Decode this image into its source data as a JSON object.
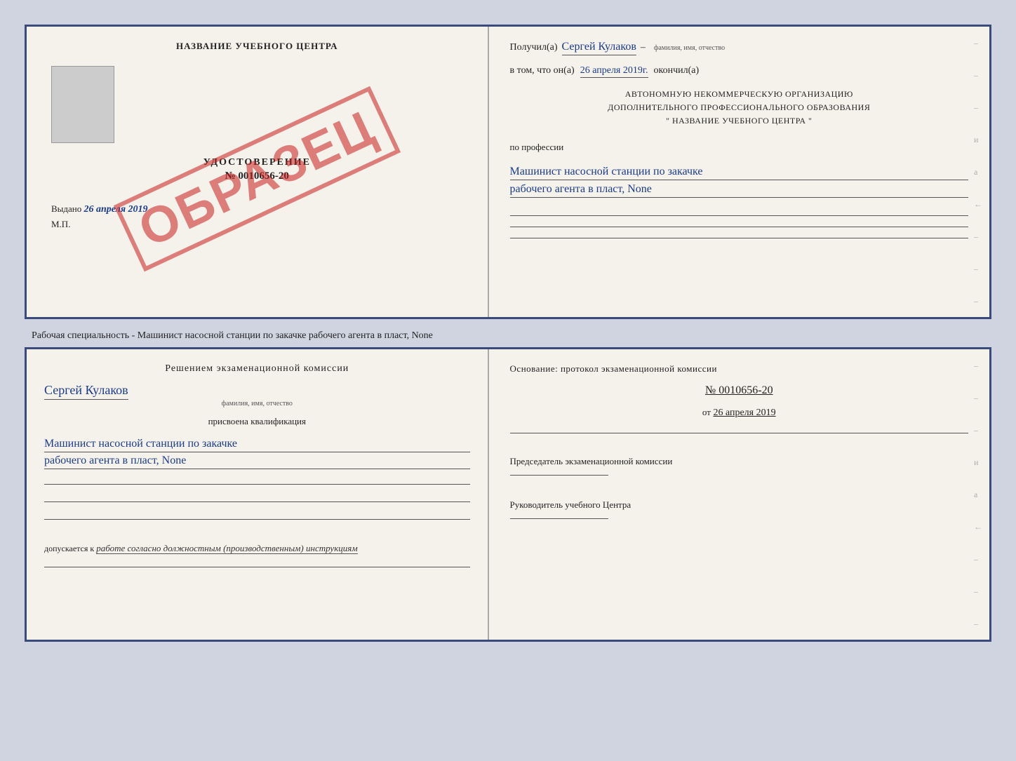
{
  "document": {
    "top_left": {
      "title": "НАЗВАНИЕ УЧЕБНОГО ЦЕНТРА",
      "photo_label": "photo",
      "udost_title": "УДОСТОВЕРЕНИЕ",
      "udost_number": "№ 0010656-20",
      "vydano_label": "Выдано",
      "vydano_date": "26 апреля 2019",
      "mp_label": "М.П.",
      "stamp": "ОБРАЗЕЦ"
    },
    "top_right": {
      "poluchil_label": "Получил(a)",
      "poluchil_name": "Сергей Кулаков",
      "familiya_hint": "фамилия, имя, отчество",
      "vtom_label": "в том, что он(а)",
      "vtom_date": "26 апреля 2019г.",
      "okonchil_label": "окончил(а)",
      "org_line1": "АВТОНОМНУЮ НЕКОММЕРЧЕСКУЮ ОРГАНИЗАЦИЮ",
      "org_line2": "ДОПОЛНИТЕЛЬНОГО ПРОФЕССИОНАЛЬНОГО ОБРАЗОВАНИЯ",
      "org_line3": "\"  НАЗВАНИЕ УЧЕБНОГО ЦЕНТРА  \"",
      "po_professii_label": "по профессии",
      "profession_line1": "Машинист насосной станции по закачке",
      "profession_line2": "рабочего агента в пласт, None",
      "dashes": [
        "-",
        "-",
        "-",
        "и",
        "а",
        "←",
        "-",
        "-",
        "-"
      ]
    },
    "middle_text": "Рабочая специальность - Машинист насосной станции по закачке рабочего агента в пласт,\nNone",
    "bottom_left": {
      "resheniem_text": "Решением экзаменационной комиссии",
      "name": "Сергей Кулаков",
      "familiya_hint": "фамилия, имя, отчество",
      "prisvoena_label": "присвоена квалификация",
      "qualification_line1": "Машинист насосной станции по закачке",
      "qualification_line2": "рабочего агента в пласт, None",
      "blank_lines": [
        "",
        "",
        ""
      ],
      "dopuskaetsya_label": "допускается к",
      "dopusk_text": "работе согласно должностным (производственным) инструкциям",
      "final_line": ""
    },
    "bottom_right": {
      "osnovaniye_label": "Основание: протокол экзаменационной комиссии",
      "protocol_number": "№ 0010656-20",
      "ot_label": "от",
      "protocol_date": "26 апреля 2019",
      "predsedatel_label": "Председатель экзаменационной комиссии",
      "rukovoditel_label": "Руководитель учебного Центра",
      "dashes": [
        "-",
        "-",
        "-",
        "и",
        "а",
        "←",
        "-",
        "-",
        "-"
      ]
    }
  }
}
